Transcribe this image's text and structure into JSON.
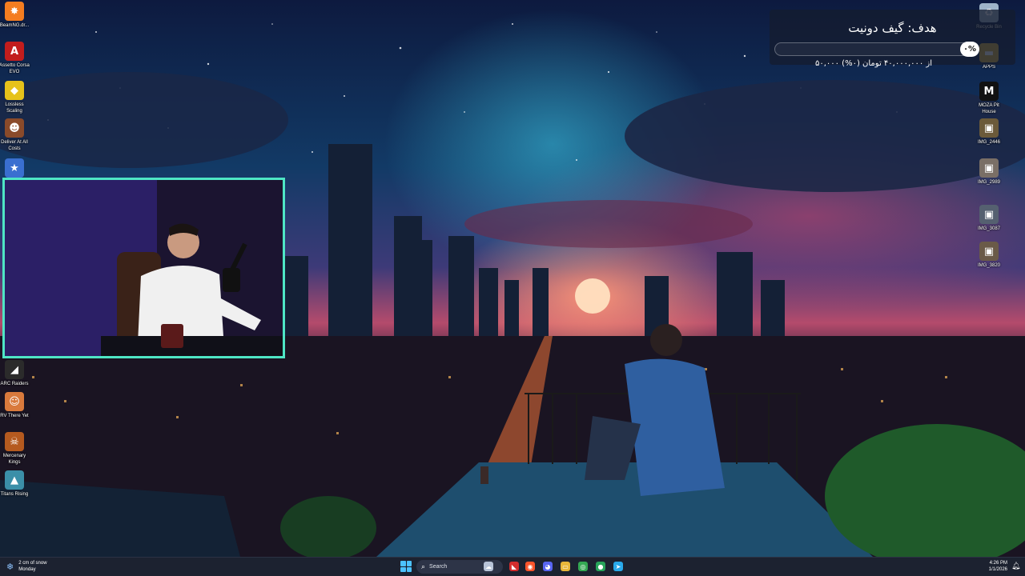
{
  "desktop": {
    "left_icons": [
      {
        "name": "beamng",
        "label": "BeamNG.dr...",
        "glyph": "✸",
        "color": "#f47d20"
      },
      {
        "name": "assetto-corsa-evo",
        "label": "Assetto Corsa EVO",
        "glyph": "A",
        "color": "#c21d1d"
      },
      {
        "name": "lossless-scaling",
        "label": "Lossless Scaling",
        "glyph": "◆",
        "color": "#e6c21a"
      },
      {
        "name": "deliver-at-all-costs",
        "label": "Deliver At All Costs",
        "glyph": "☻",
        "color": "#8a4a2a"
      },
      {
        "name": "game-icon-5",
        "label": "",
        "glyph": "★",
        "color": "#3a6fd0"
      },
      {
        "name": "arc-raiders",
        "label": "ARC Raiders",
        "glyph": "◢",
        "color": "#2b2b2b"
      },
      {
        "name": "rv-there-yet",
        "label": "RV There Yet",
        "glyph": "☺",
        "color": "#d97a3c"
      },
      {
        "name": "mercenary-kings",
        "label": "Mercenary Kings",
        "glyph": "☠",
        "color": "#b55a1f"
      },
      {
        "name": "titans-rising",
        "label": "Titans Rising",
        "glyph": "▲",
        "color": "#3b8fa8"
      }
    ],
    "right_icons": [
      {
        "name": "recycle-bin",
        "label": "Recycle Bin",
        "glyph": "♻",
        "color": "#9fb4c8"
      },
      {
        "name": "apps-folder",
        "label": "APPS",
        "glyph": "▬",
        "color": "#d9b13c"
      },
      {
        "name": "moza-pit-house",
        "label": "MOZA Pit House",
        "glyph": "M",
        "color": "#111111"
      },
      {
        "name": "img-2446",
        "label": "IMG_2446",
        "glyph": "▣",
        "color": "#6b5a3a"
      },
      {
        "name": "img-2989",
        "label": "IMG_2989",
        "glyph": "▣",
        "color": "#7a6f66"
      },
      {
        "name": "img-3087",
        "label": "IMG_3087",
        "glyph": "▣",
        "color": "#556070"
      },
      {
        "name": "img-3820",
        "label": "IMG_3820",
        "glyph": "▣",
        "color": "#6a5a48"
      }
    ]
  },
  "donation": {
    "title": "هدف: گیف دونیت",
    "badge": "۰%",
    "progress": 0,
    "subtitle": "۵۰,۰۰۰ از ۴۰,۰۰۰,۰۰۰ تومان (۰%)"
  },
  "taskbar": {
    "weather_line1": "2 cm of snow",
    "weather_line2": "Monday",
    "search_placeholder": "Search",
    "apps": [
      {
        "name": "snow-cloud",
        "glyph": "☁",
        "color": "#b8c4d8"
      },
      {
        "name": "app-red",
        "glyph": "◣",
        "color": "#d22d2d"
      },
      {
        "name": "brave-browser",
        "glyph": "◉",
        "color": "#fb542b"
      },
      {
        "name": "discord",
        "glyph": "◕",
        "color": "#5865f2"
      },
      {
        "name": "file-explorer",
        "glyph": "▭",
        "color": "#e8b73a"
      },
      {
        "name": "chrome",
        "glyph": "◎",
        "color": "#34a853"
      },
      {
        "name": "app-green",
        "glyph": "●",
        "color": "#27a35a"
      },
      {
        "name": "telegram",
        "glyph": "➤",
        "color": "#29a9eb"
      }
    ],
    "time": "4:26 PM",
    "date": "1/1/2026"
  }
}
